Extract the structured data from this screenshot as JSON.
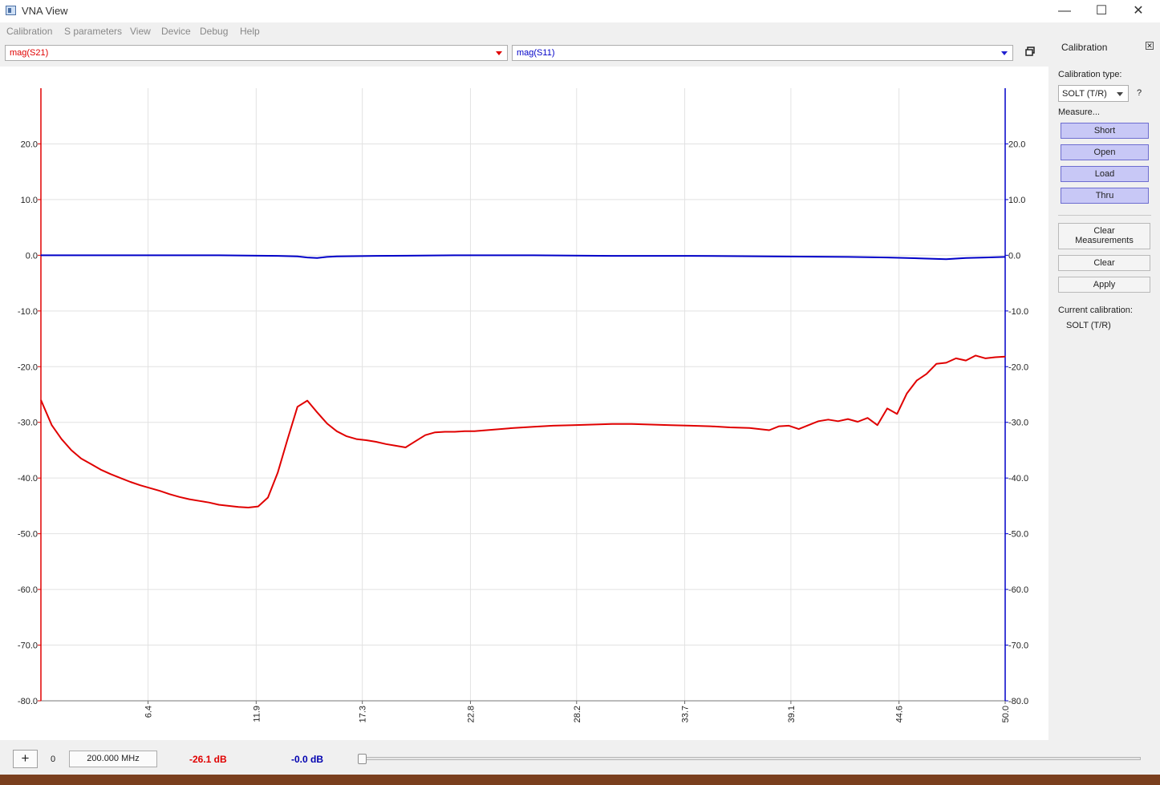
{
  "window": {
    "title": "VNA View",
    "minimize_glyph": "—",
    "maximize_glyph": "☐",
    "close_glyph": "✕"
  },
  "menu": [
    "Calibration",
    "S parameters",
    "View",
    "Device",
    "Debug",
    "Help"
  ],
  "traces": {
    "left_select": {
      "value": "mag(S21)",
      "color": "#e00000"
    },
    "right_select": {
      "value": "mag(S11)",
      "color": "#0000c8"
    }
  },
  "calibration_panel": {
    "title": "Calibration",
    "type_label": "Calibration type:",
    "type_value": "SOLT (T/R)",
    "help": "?",
    "measure_label": "Measure...",
    "measure_buttons": [
      "Short",
      "Open",
      "Load",
      "Thru"
    ],
    "clear_measurements_label": [
      "Clear",
      "Measurements"
    ],
    "clear_label": "Clear",
    "apply_label": "Apply",
    "current_label": "Current calibration:",
    "current_value": "SOLT (T/R)"
  },
  "marker_bar": {
    "add_label": "+",
    "index": "0",
    "frequency": "200.000 MHz",
    "value_s21": "-26.1 dB",
    "value_s11": "-0.0 dB",
    "slider_position": 0
  },
  "chart_data": {
    "type": "line",
    "x_ticks": [
      "6.4",
      "11.9",
      "17.3",
      "22.8",
      "28.2",
      "33.7",
      "39.1",
      "44.6",
      "50.0"
    ],
    "y_ticks": [
      "20.0",
      "10.0",
      "0.0",
      "-10.0",
      "-20.0",
      "-30.0",
      "-40.0",
      "-50.0",
      "-60.0",
      "-70.0",
      "-80.0"
    ],
    "xlim": [
      0.95,
      50.0
    ],
    "ylim": [
      -80,
      30
    ],
    "grid": true,
    "series": [
      {
        "name": "mag(S21)",
        "color": "#e00000",
        "x": [
          0.95,
          1.5,
          2,
          2.5,
          3,
          3.5,
          4,
          4.5,
          5,
          5.5,
          6,
          6.5,
          7,
          7.5,
          8,
          8.5,
          9,
          9.5,
          10,
          10.5,
          11,
          11.5,
          12,
          12.5,
          13,
          13.5,
          14,
          14.5,
          15,
          15.5,
          16,
          16.5,
          17,
          17.5,
          18,
          18.5,
          19,
          19.5,
          20,
          20.5,
          21,
          21.5,
          22,
          22.5,
          23,
          24,
          25,
          26,
          27,
          28,
          29,
          30,
          31,
          32,
          33,
          34,
          35,
          36,
          37,
          38,
          38.5,
          39,
          39.5,
          40,
          40.5,
          41,
          41.5,
          42,
          42.5,
          43,
          43.5,
          44,
          44.5,
          45,
          45.5,
          46,
          46.5,
          47,
          47.5,
          48,
          48.5,
          49,
          49.5,
          50
        ],
        "y": [
          -26,
          -30.5,
          -33,
          -35,
          -36.5,
          -37.5,
          -38.5,
          -39.3,
          -40,
          -40.7,
          -41.3,
          -41.8,
          -42.3,
          -42.9,
          -43.4,
          -43.8,
          -44.1,
          -44.4,
          -44.8,
          -45,
          -45.2,
          -45.3,
          -45.1,
          -43.5,
          -39,
          -33,
          -27.2,
          -26.1,
          -28.2,
          -30.2,
          -31.6,
          -32.5,
          -33,
          -33.2,
          -33.5,
          -33.9,
          -34.2,
          -34.5,
          -33.4,
          -32.3,
          -31.8,
          -31.7,
          -31.7,
          -31.6,
          -31.6,
          -31.3,
          -31,
          -30.8,
          -30.6,
          -30.5,
          -30.4,
          -30.3,
          -30.3,
          -30.4,
          -30.5,
          -30.6,
          -30.7,
          -30.9,
          -31,
          -31.4,
          -30.7,
          -30.6,
          -31.2,
          -30.5,
          -29.8,
          -29.5,
          -29.8,
          -29.4,
          -29.9,
          -29.2,
          -30.5,
          -27.5,
          -28.5,
          -24.8,
          -22.5,
          -21.3,
          -19.5,
          -19.3,
          -18.5,
          -18.9,
          -18,
          -18.5,
          -18.3,
          -18.2
        ]
      },
      {
        "name": "mag(S11)",
        "color": "#0000c8",
        "x": [
          0.95,
          5,
          10,
          13,
          14,
          14.5,
          15,
          15.5,
          16,
          18,
          22,
          26,
          30,
          34,
          38,
          42,
          44,
          45,
          46,
          47,
          47.5,
          48,
          49,
          50
        ],
        "y": [
          0,
          0,
          0,
          -0.1,
          -0.2,
          -0.4,
          -0.5,
          -0.3,
          -0.2,
          -0.1,
          0,
          0,
          -0.1,
          -0.1,
          -0.2,
          -0.3,
          -0.4,
          -0.5,
          -0.6,
          -0.7,
          -0.6,
          -0.5,
          -0.4,
          -0.3
        ]
      }
    ]
  }
}
